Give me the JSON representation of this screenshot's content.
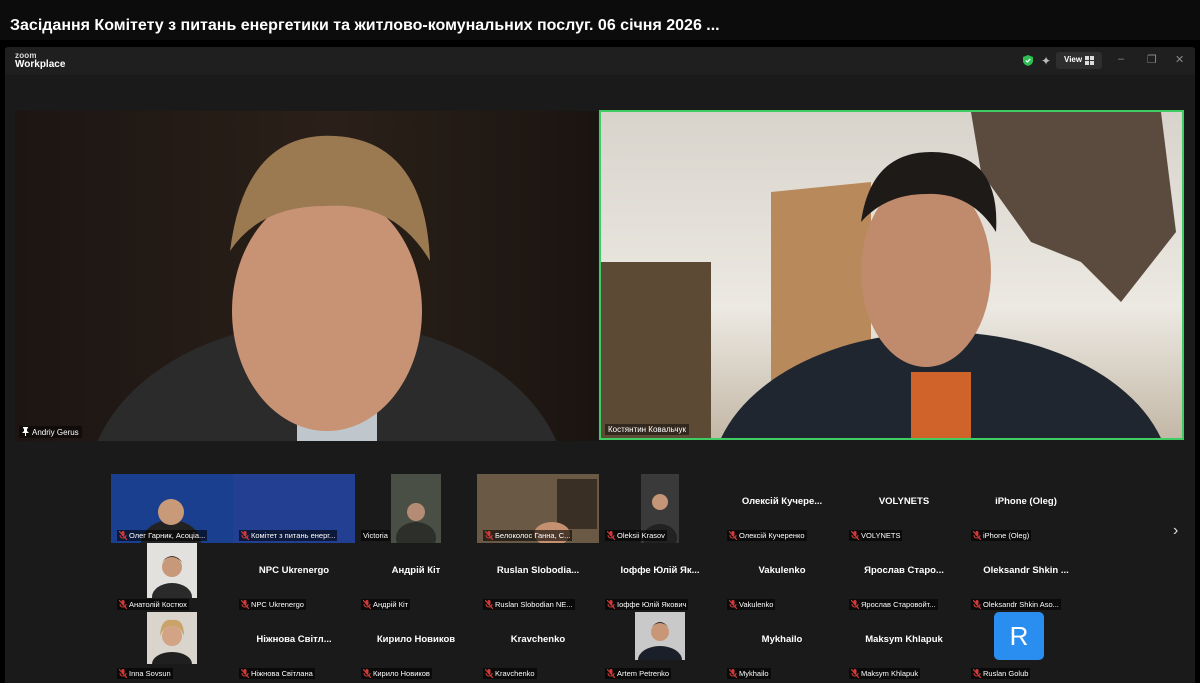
{
  "title": "Засідання Комітету з питань енергетики та житлово-комунальних послуг. 06 січня 2026 ...",
  "app": {
    "brand_small": "zoom",
    "brand_large": "Workplace",
    "view_label": "View"
  },
  "colors": {
    "active_speaker_border": "#3fcc62",
    "mic_off": "#d23a3a",
    "avatar_blue": "#2a8ef0"
  },
  "icons": [
    "shield-icon",
    "sparkle-icon",
    "grid-icon",
    "minimize-icon",
    "restore-icon",
    "close-icon",
    "pin-icon",
    "mic-off-icon",
    "chevron-right-icon"
  ],
  "main_tiles": [
    {
      "name": "Andriy Gerus"
    },
    {
      "name": "Костянтин Ковальчук"
    }
  ],
  "rows": [
    [
      {
        "label": "Олег Гарник, Асоціа...",
        "display": ""
      },
      {
        "label": "Комітет з питань енерг...",
        "display": ""
      },
      {
        "label": "Victoria",
        "display": ""
      },
      {
        "label": "Белоколос Ганна, С...",
        "display": ""
      },
      {
        "label": "Oleksii Krasov",
        "display": ""
      },
      {
        "label": "Олексій Кучеренко",
        "display": "Олексій Кучере..."
      },
      {
        "label": "VOLYNETS",
        "display": "VOLYNETS"
      },
      {
        "label": "iPhone (Oleg)",
        "display": "iPhone (Oleg)"
      }
    ],
    [
      {
        "label": "Анатолій Костюх",
        "display": ""
      },
      {
        "label": "NPC Ukrenergo",
        "display": "NPC Ukrenergo"
      },
      {
        "label": "Андрій Кіт",
        "display": "Андрій Кіт"
      },
      {
        "label": "Ruslan Slobodian NE...",
        "display": "Ruslan  Slobodia..."
      },
      {
        "label": "Іоффе Юлій Якович",
        "display": "Іоффе Юлій Як..."
      },
      {
        "label": "Vakulenko",
        "display": "Vakulenko"
      },
      {
        "label": "Ярослав Старовойт...",
        "display": "Ярослав  Старо..."
      },
      {
        "label": "Oleksandr Shkin Aso...",
        "display": "Oleksandr  Shkin ..."
      }
    ],
    [
      {
        "label": "Inna Sovsun",
        "display": ""
      },
      {
        "label": "Ніжнова Світлана",
        "display": "Ніжнова  Світл..."
      },
      {
        "label": "Кирило Новиков",
        "display": "Кирило Новиков"
      },
      {
        "label": "Kravchenko",
        "display": "Kravchenko"
      },
      {
        "label": "Artem Petrenko",
        "display": ""
      },
      {
        "label": "Mykhailo",
        "display": "Mykhailo"
      },
      {
        "label": "Maksym Khlapuk",
        "display": "Maksym  Khlapuk"
      },
      {
        "label": "Ruslan Golub",
        "display": ""
      }
    ]
  ],
  "avatar_letter": "R",
  "next_page_glyph": "›"
}
